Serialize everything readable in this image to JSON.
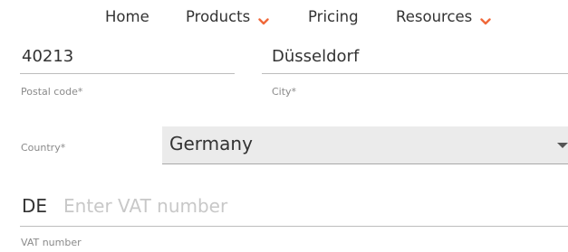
{
  "nav": {
    "items": [
      {
        "label": "Home",
        "has_dropdown": false
      },
      {
        "label": "Products",
        "has_dropdown": true
      },
      {
        "label": "Pricing",
        "has_dropdown": false
      },
      {
        "label": "Resources",
        "has_dropdown": true
      }
    ],
    "chevron_icon": "chevron-down-icon",
    "accent_color": "#f0683a"
  },
  "form": {
    "postal_code": {
      "value": "40213",
      "label": "Postal code*"
    },
    "city": {
      "value": "Düsseldorf",
      "label": "City*"
    },
    "country": {
      "label": "Country*",
      "selected": "Germany"
    },
    "vat": {
      "prefix": "DE",
      "placeholder": "Enter VAT number",
      "value": "",
      "label": "VAT number"
    }
  }
}
